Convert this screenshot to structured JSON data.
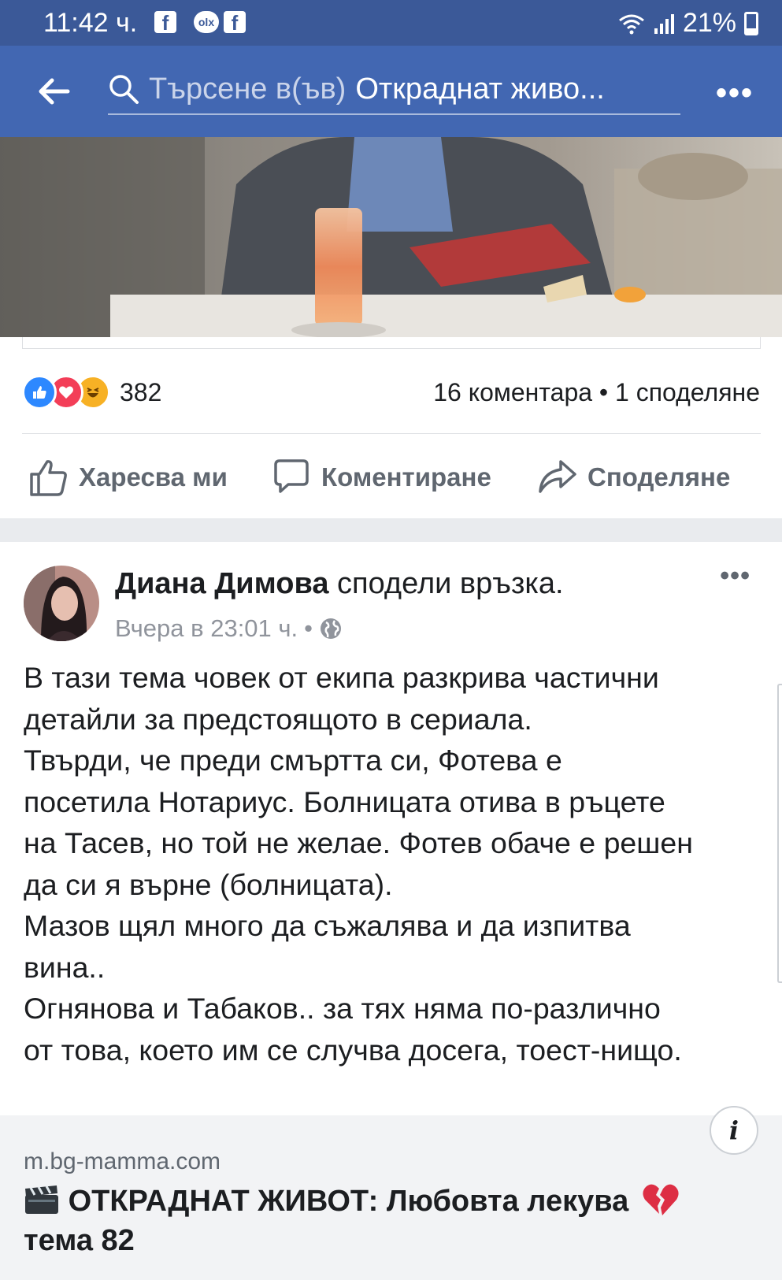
{
  "status_bar": {
    "time": "11:42 ч.",
    "notification_icons": [
      "facebook-icon",
      "olx-icon",
      "facebook-icon"
    ],
    "olx_label": "olx",
    "battery": "21%"
  },
  "app_bar": {
    "search_placeholder": "Търсене в(ъв)",
    "search_query": "Откраднат живо..."
  },
  "post1": {
    "reaction_count": "382",
    "stats": "16 коментара • 1 споделяне",
    "actions": {
      "like": "Харесва ми",
      "comment": "Коментиране",
      "share": "Споделяне"
    }
  },
  "post2": {
    "author": "Диана Димова",
    "action_text": "сподели връзка.",
    "timestamp": "Вчера в 23:01 ч.",
    "separator": "•",
    "text_lines": [
      "В тази тема човек от екипа разкрива частични",
      "детайли за предстоящото в сериала.",
      "Твърди, че преди смъртта си, Фотева е",
      "посетила Нотариус. Болницата отива в ръцете",
      "на Тасев, но той не желае. Фотев обаче е решен",
      "да си я върне (болницата).",
      "Мазов щял много да съжалява и да изпитва",
      "вина..",
      "Огнянова и Табаков.. за тях няма по-различно",
      "от това, което им се случва досега, тоест-нищо."
    ],
    "link": {
      "domain": "m.bg-mamma.com",
      "title_line1": "ОТКРАДНАТ ЖИВОТ: Любовта лекува",
      "title_line2": "тема 82",
      "info_label": "i"
    }
  },
  "colors": {
    "status_bar": "#3b5998",
    "app_bar": "#4267b2",
    "like_blue": "#2d88ff",
    "love_red": "#f33e58",
    "haha_yellow": "#f7b125",
    "secondary_text": "#606770"
  }
}
